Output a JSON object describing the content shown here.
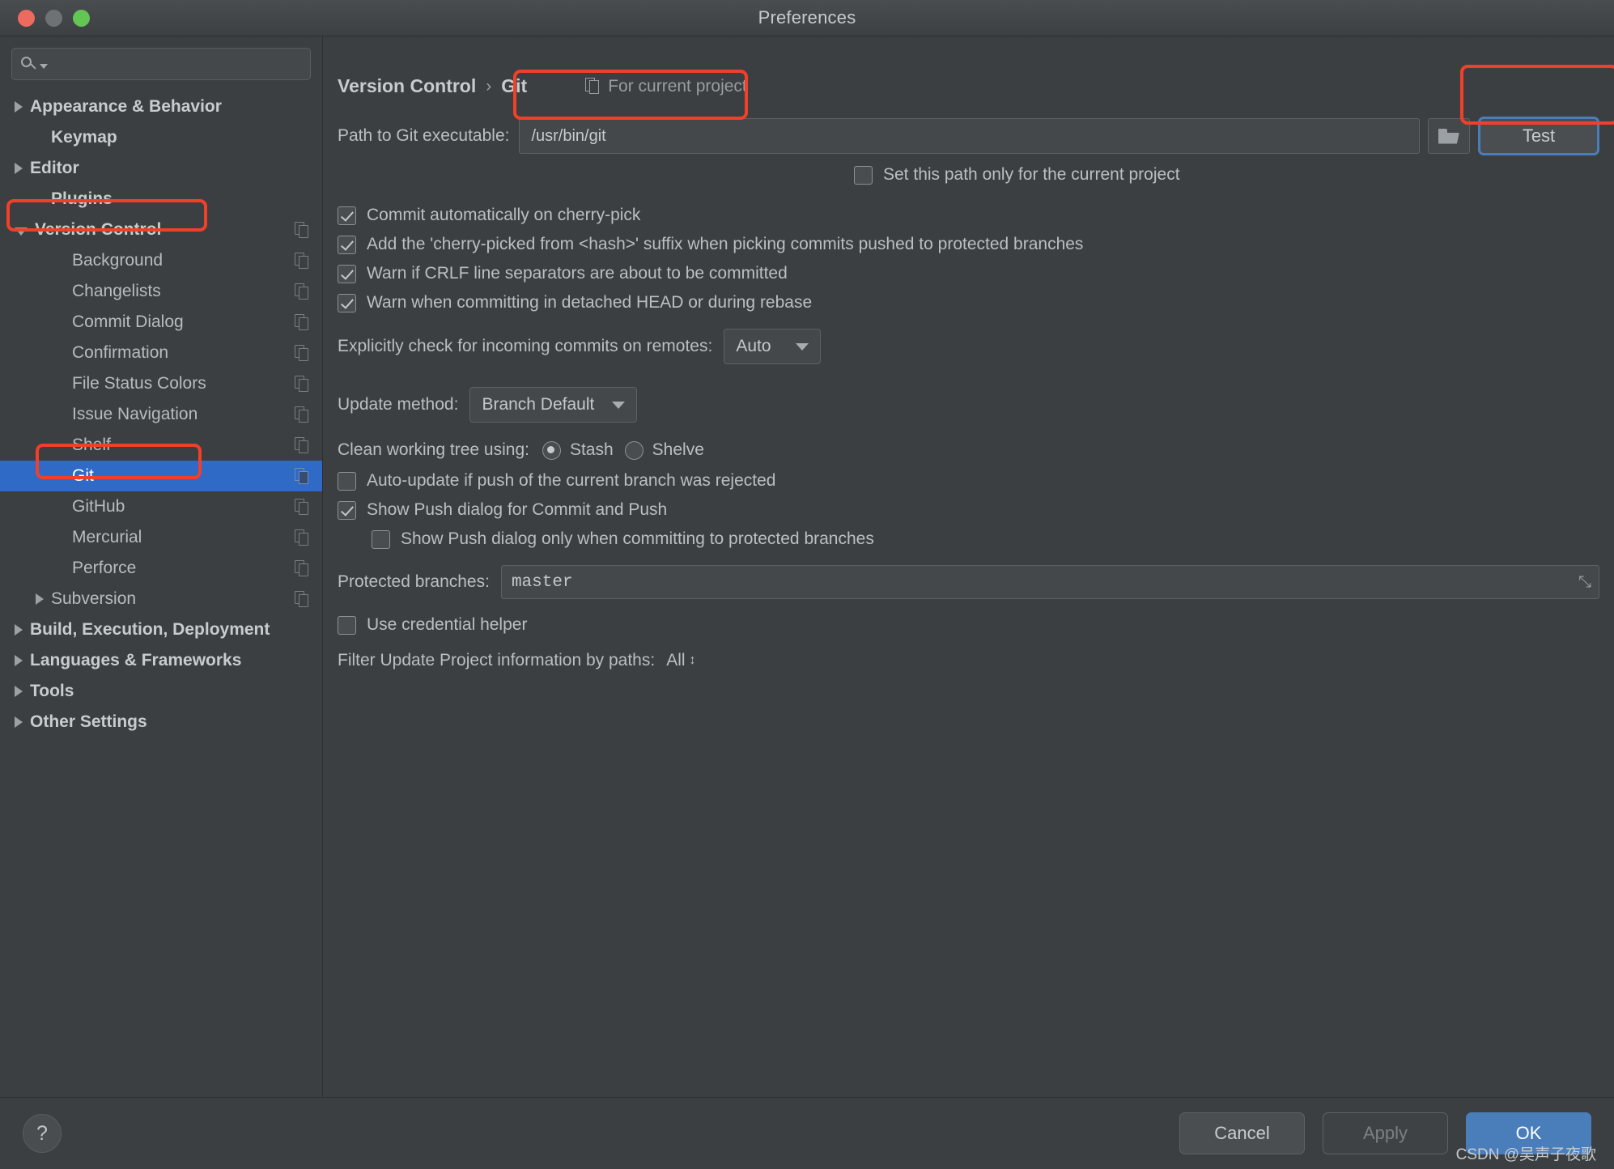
{
  "window": {
    "title": "Preferences",
    "traffic_lights": [
      "close",
      "minimize",
      "zoom"
    ]
  },
  "search": {
    "placeholder": "",
    "value": ""
  },
  "sidebar": {
    "items": [
      {
        "label": "Appearance & Behavior",
        "arrow": "right",
        "bold": true,
        "indent": 0,
        "copy": false,
        "selected": false
      },
      {
        "label": "Keymap",
        "arrow": "none",
        "bold": true,
        "indent": 1,
        "copy": false,
        "selected": false
      },
      {
        "label": "Editor",
        "arrow": "right",
        "bold": true,
        "indent": 0,
        "copy": false,
        "selected": false
      },
      {
        "label": "Plugins",
        "arrow": "none",
        "bold": true,
        "indent": 1,
        "copy": false,
        "selected": false
      },
      {
        "label": "Version Control",
        "arrow": "down",
        "bold": true,
        "indent": 0,
        "copy": true,
        "selected": false
      },
      {
        "label": "Background",
        "arrow": "none",
        "bold": false,
        "indent": 2,
        "copy": true,
        "selected": false
      },
      {
        "label": "Changelists",
        "arrow": "none",
        "bold": false,
        "indent": 2,
        "copy": true,
        "selected": false
      },
      {
        "label": "Commit Dialog",
        "arrow": "none",
        "bold": false,
        "indent": 2,
        "copy": true,
        "selected": false
      },
      {
        "label": "Confirmation",
        "arrow": "none",
        "bold": false,
        "indent": 2,
        "copy": true,
        "selected": false
      },
      {
        "label": "File Status Colors",
        "arrow": "none",
        "bold": false,
        "indent": 2,
        "copy": true,
        "selected": false
      },
      {
        "label": "Issue Navigation",
        "arrow": "none",
        "bold": false,
        "indent": 2,
        "copy": true,
        "selected": false
      },
      {
        "label": "Shelf",
        "arrow": "none",
        "bold": false,
        "indent": 2,
        "copy": true,
        "selected": false
      },
      {
        "label": "Git",
        "arrow": "none",
        "bold": false,
        "indent": 2,
        "copy": true,
        "selected": true
      },
      {
        "label": "GitHub",
        "arrow": "none",
        "bold": false,
        "indent": 2,
        "copy": true,
        "selected": false
      },
      {
        "label": "Mercurial",
        "arrow": "none",
        "bold": false,
        "indent": 2,
        "copy": true,
        "selected": false
      },
      {
        "label": "Perforce",
        "arrow": "none",
        "bold": false,
        "indent": 2,
        "copy": true,
        "selected": false
      },
      {
        "label": "Subversion",
        "arrow": "right",
        "bold": false,
        "indent": 1,
        "copy": true,
        "selected": false
      },
      {
        "label": "Build, Execution, Deployment",
        "arrow": "right",
        "bold": true,
        "indent": 0,
        "copy": false,
        "selected": false
      },
      {
        "label": "Languages & Frameworks",
        "arrow": "right",
        "bold": true,
        "indent": 0,
        "copy": false,
        "selected": false
      },
      {
        "label": "Tools",
        "arrow": "right",
        "bold": true,
        "indent": 0,
        "copy": false,
        "selected": false
      },
      {
        "label": "Other Settings",
        "arrow": "right",
        "bold": true,
        "indent": 0,
        "copy": false,
        "selected": false
      }
    ]
  },
  "main": {
    "breadcrumb": {
      "root": "Version Control",
      "separator": "›",
      "leaf": "Git"
    },
    "scope_label": "For current project",
    "path_row": {
      "label": "Path to Git executable:",
      "value": "/usr/bin/git",
      "browse_icon": "folder-icon",
      "test_button": "Test"
    },
    "set_path_checkbox": {
      "label": "Set this path only for the current project",
      "checked": false
    },
    "checkboxes": [
      {
        "label": "Commit automatically on cherry-pick",
        "checked": true
      },
      {
        "label": "Add the 'cherry-picked from <hash>' suffix when picking commits pushed to protected branches",
        "checked": true
      },
      {
        "label": "Warn if CRLF line separators are about to be committed",
        "checked": true
      },
      {
        "label": "Warn when committing in detached HEAD or during rebase",
        "checked": true
      }
    ],
    "incoming_commits": {
      "label": "Explicitly check for incoming commits on remotes:",
      "value": "Auto"
    },
    "update_method": {
      "label": "Update method:",
      "value": "Branch Default"
    },
    "clean_tree": {
      "label": "Clean working tree using:",
      "options": [
        {
          "label": "Stash",
          "selected": true
        },
        {
          "label": "Shelve",
          "selected": false
        }
      ]
    },
    "push_checkboxes": [
      {
        "label": "Auto-update if push of the current branch was rejected",
        "checked": false,
        "indented": false
      },
      {
        "label": "Show Push dialog for Commit and Push",
        "checked": true,
        "indented": false
      },
      {
        "label": "Show Push dialog only when committing to protected branches",
        "checked": false,
        "indented": true
      }
    ],
    "protected_branches": {
      "label": "Protected branches:",
      "value": "master",
      "expand_icon": "expand-icon"
    },
    "credential_helper": {
      "label": "Use credential helper",
      "checked": false
    },
    "filter_paths": {
      "label": "Filter Update Project information by paths:",
      "value": "All"
    }
  },
  "footer": {
    "help_icon": "?",
    "cancel": "Cancel",
    "apply": "Apply",
    "ok": "OK",
    "watermark": "CSDN @吴声子夜歌"
  },
  "colors": {
    "accent_blue": "#4a7ebb",
    "selection_blue": "#2f6ac7",
    "annotation_red": "#f0402a",
    "panel_bg": "#3c3f41"
  }
}
